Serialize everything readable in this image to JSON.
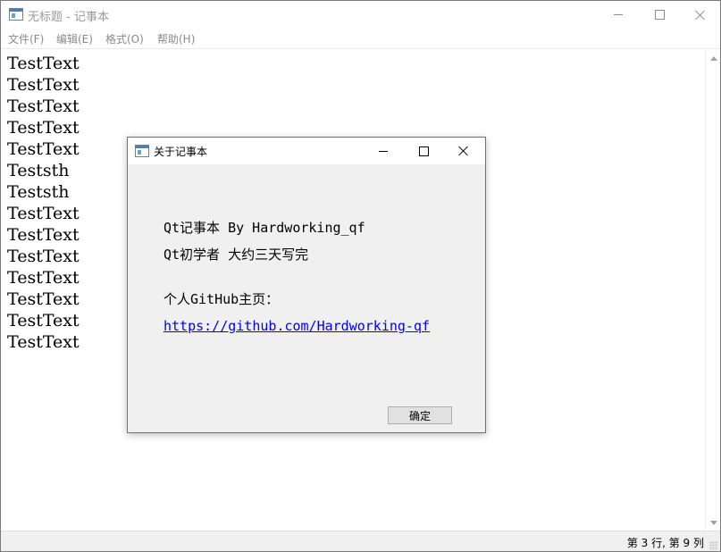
{
  "window": {
    "title": "无标题 - 记事本",
    "icon": "notepad-icon"
  },
  "menu": [
    {
      "label": "文件(F)"
    },
    {
      "label": "编辑(E)"
    },
    {
      "label": "格式(O)"
    },
    {
      "label": "帮助(H)"
    }
  ],
  "editor": {
    "lines": [
      "TestText",
      "TestText",
      "TestText",
      "TestText",
      "TestText",
      "Teststh",
      "Teststh",
      "TestText",
      "TestText",
      "TestText",
      "TestText",
      "TestText",
      "TestText",
      "TestText"
    ]
  },
  "statusbar": {
    "position": "第 3 行, 第 9 列"
  },
  "dialog": {
    "title": "关于记事本",
    "line1": "Qt记事本 By Hardworking_qf",
    "line2": "Qt初学者 大约三天写完",
    "line3": "个人GitHub主页：",
    "link": "https://github.com/Hardworking-qf",
    "ok_label": "确定"
  },
  "colors": {
    "link": "#0000ee",
    "dialog_bg": "#f0f0f0",
    "statusbar_bg": "#f0f0f0"
  }
}
